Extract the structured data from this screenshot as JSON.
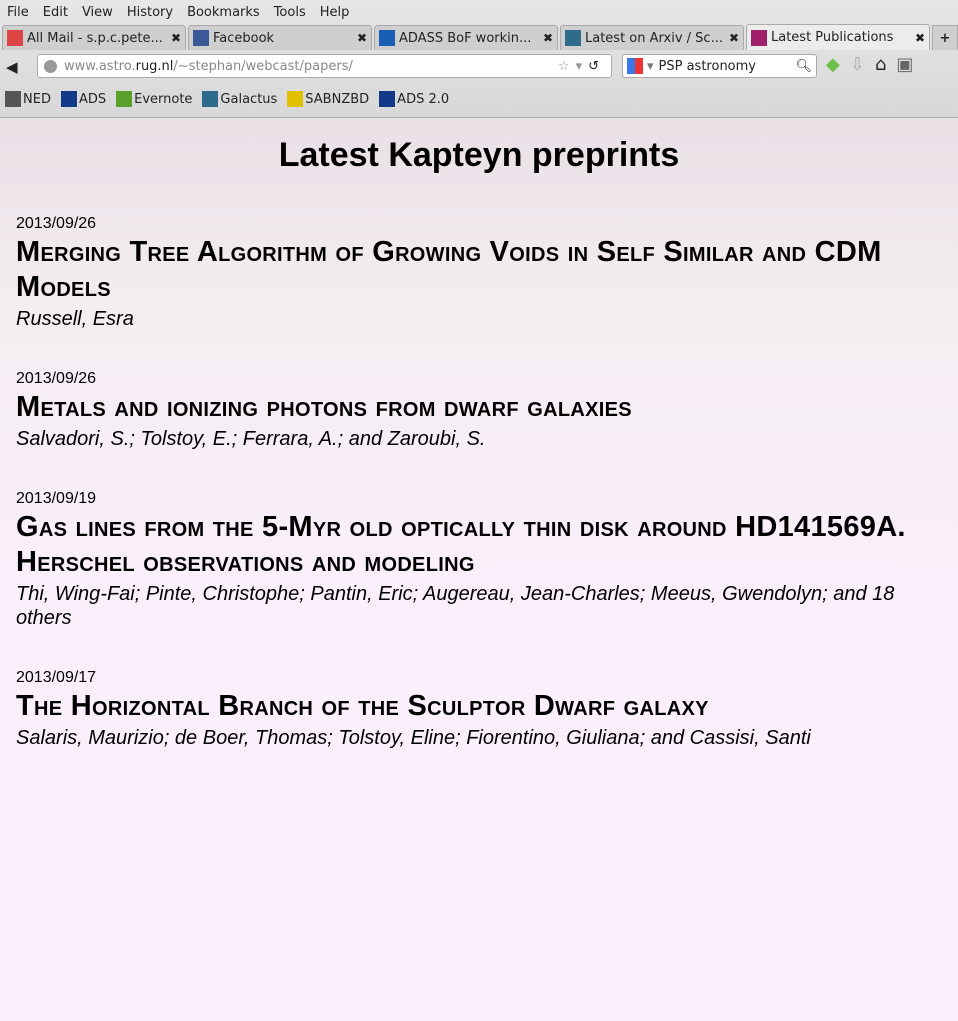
{
  "menu": [
    "File",
    "Edit",
    "View",
    "History",
    "Bookmarks",
    "Tools",
    "Help"
  ],
  "tabs": [
    {
      "label": "All Mail - s.p.c.pete...",
      "icon": "gmail-icon",
      "color": "#d44"
    },
    {
      "label": "Facebook",
      "icon": "facebook-icon",
      "color": "#3b5998"
    },
    {
      "label": "ADASS BoF workin...",
      "icon": "star-icon",
      "color": "#1a5fb4"
    },
    {
      "label": "Latest on Arxiv / Sc...",
      "icon": "sf-icon",
      "color": "#2f6b8a"
    },
    {
      "label": "Latest Publications",
      "icon": "feather-icon",
      "color": "#a0206a",
      "active": true
    }
  ],
  "url": {
    "pre": "www.astro.",
    "domain": "rug.nl",
    "post": "/~stephan/webcast/papers/"
  },
  "search": {
    "value": "PSP astronomy"
  },
  "bookmarks": [
    {
      "label": "NED",
      "icon": "ned-icon",
      "color": "#555"
    },
    {
      "label": "ADS",
      "icon": "ads-icon",
      "color": "#123a8a"
    },
    {
      "label": "Evernote",
      "icon": "evernote-icon",
      "color": "#5aa02c"
    },
    {
      "label": "Galactus",
      "icon": "sf-icon",
      "color": "#2f6b8a"
    },
    {
      "label": "SABNZBD",
      "icon": "sabnzbd-icon",
      "color": "#e0c000"
    },
    {
      "label": "ADS 2.0",
      "icon": "ads-icon",
      "color": "#123a8a"
    }
  ],
  "page": {
    "heading": "Latest Kapteyn preprints",
    "entries": [
      {
        "date": "2013/09/26",
        "title": "Merging Tree Algorithm of Growing Voids in Self Similar and CDM Models",
        "authors": "Russell, Esra"
      },
      {
        "date": "2013/09/26",
        "title": "Metals and ionizing photons from dwarf galaxies",
        "authors": "Salvadori, S.; Tolstoy, E.; Ferrara, A.; and Zaroubi, S."
      },
      {
        "date": "2013/09/19",
        "title": "Gas lines from the 5-Myr old optically thin disk around HD141569A. Herschel observations and modeling",
        "authors": "Thi, Wing-Fai; Pinte, Christophe; Pantin, Eric; Augereau, Jean-Charles; Meeus, Gwendolyn; and 18 others"
      },
      {
        "date": "2013/09/17",
        "title": "The Horizontal Branch of the Sculptor Dwarf galaxy",
        "authors": "Salaris, Maurizio; de Boer, Thomas; Tolstoy, Eline; Fiorentino, Giuliana; and Cassisi, Santi"
      }
    ]
  }
}
